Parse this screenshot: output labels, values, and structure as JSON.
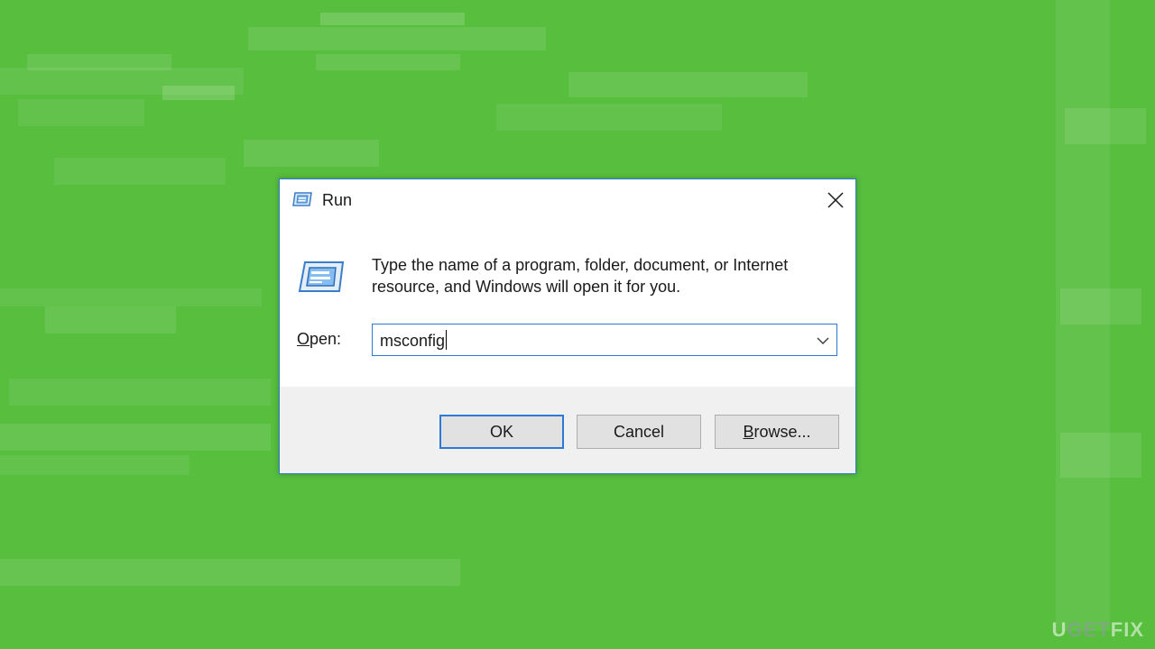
{
  "dialog": {
    "title": "Run",
    "description": "Type the name of a program, folder, document, or Internet resource, and Windows will open it for you.",
    "open_label_mnemonic": "O",
    "open_label_rest": "pen:",
    "input_value": "msconfig",
    "buttons": {
      "ok": "OK",
      "cancel": "Cancel",
      "browse_mnemonic": "B",
      "browse_rest": "rowse..."
    }
  },
  "watermark": {
    "part1": "U",
    "part2": "GET",
    "part3": "FIX"
  },
  "colors": {
    "background": "#57be3e",
    "accent": "#2b7bd6",
    "footer": "#f0f0f0"
  },
  "icons": {
    "title_icon": "run-icon",
    "close_icon": "close-icon",
    "dropdown_icon": "chevron-down-icon"
  }
}
